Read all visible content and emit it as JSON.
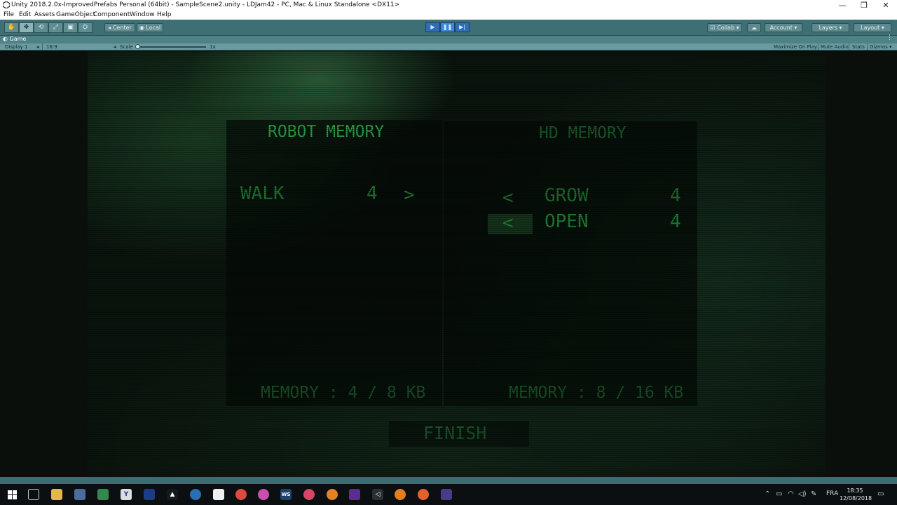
{
  "window": {
    "title": "Unity 2018.2.0x-ImprovedPrefabs Personal (64bit) - SampleScene2.unity - LDJam42 - PC, Mac & Linux Standalone <DX11>",
    "controls": {
      "minimize": "—",
      "restore": "❐",
      "close": "✕"
    }
  },
  "menu": [
    "File",
    "Edit",
    "Assets",
    "GameObject",
    "Component",
    "Window",
    "Help"
  ],
  "toolbar": {
    "tools": [
      "✋",
      "✥",
      "⟲",
      "⤢",
      "▣",
      "⛭"
    ],
    "pivot_label": "Center",
    "space_label": "Local",
    "play_icons": {
      "play": "▶",
      "pause": "❚❚",
      "step": "▶|"
    },
    "collab_label": "Collab",
    "account_label": "Account",
    "layers_label": "Layers",
    "layout_label": "Layout"
  },
  "game_tab": {
    "label": "Game",
    "display": "Display 1",
    "aspect": "16:9",
    "scale_label": "Scale",
    "scale_value": "1x",
    "maximize_on_play": "Maximize On Play",
    "mute_audio": "Mute Audio",
    "stats": "Stats",
    "gizmos": "Gizmos"
  },
  "game": {
    "left_title": "ROBOT MEMORY",
    "right_title": "HD MEMORY",
    "robot_items": [
      {
        "name": "WALK",
        "size": "4",
        "arrow": ">"
      }
    ],
    "hd_items": [
      {
        "arrow": "<",
        "name": "GROW",
        "size": "4"
      },
      {
        "arrow": "<",
        "name": "OPEN",
        "size": "4"
      }
    ],
    "robot_memory": "MEMORY : 4 / 8 KB",
    "hd_memory": "MEMORY : 8 / 16 KB",
    "finish_label": "FINISH"
  },
  "taskbar": {
    "language": "FRA",
    "time": "18:35",
    "date": "12/08/2018"
  },
  "colors": {
    "toolbar": "#3d6f74",
    "crt_green": "#2fa548",
    "crt_dim": "#164f26"
  }
}
